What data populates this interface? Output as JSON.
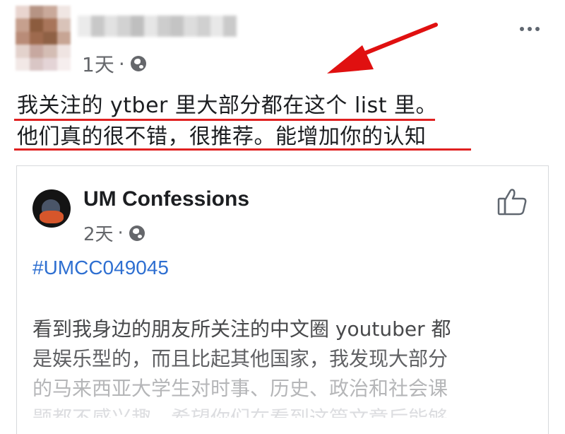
{
  "post": {
    "timestamp": "1天",
    "separator": "·",
    "text_line1": "我关注的 ytber 里大部分都在这个 list 里。",
    "text_line2": "他们真的很不错，很推荐。能增加你的认知",
    "annotation_color": "#e02020"
  },
  "shared": {
    "page_name": "UM Confessions",
    "timestamp": "2天",
    "separator": "·",
    "hashtag": "#UMCC049045",
    "body_lines": [
      "看到我身边的朋友所关注的中文圈 youtuber 都",
      "是娱乐型的，而且比起其他国家，我发现大部分",
      "的马来西亚大学生对时事、历史、政治和社会课",
      "题都不感兴趣，希望你们在看到这篇文章后能够"
    ],
    "hashtag_color": "#2e6fd1"
  },
  "icons": [
    "globe-icon",
    "more-options-icon",
    "thumbs-up-icon",
    "red-arrow-annotation"
  ]
}
